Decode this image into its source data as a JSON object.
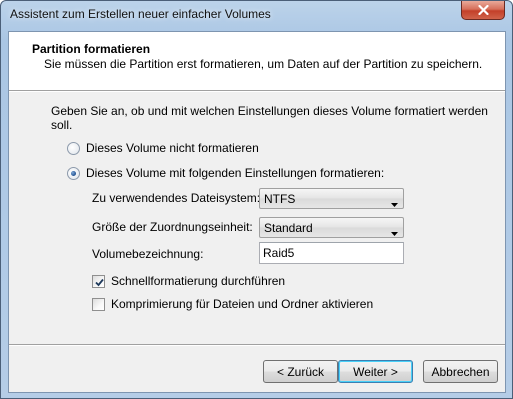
{
  "window": {
    "title": "Assistent zum Erstellen neuer einfacher Volumes",
    "close_icon": "close-icon"
  },
  "header": {
    "title": "Partition formatieren",
    "subtitle": "Sie müssen die Partition erst formatieren, um Daten auf der Partition zu speichern."
  },
  "body": {
    "instruction": "Geben Sie an, ob und mit welchen Einstellungen dieses Volume formatiert werden soll.",
    "radio_no_format": {
      "label": "Dieses Volume nicht formatieren",
      "selected": false
    },
    "radio_format": {
      "label": "Dieses Volume mit folgenden Einstellungen formatieren:",
      "selected": true
    },
    "filesystem": {
      "label": "Zu verwendendes Dateisystem:",
      "value": "NTFS"
    },
    "allocation_unit": {
      "label": "Größe der Zuordnungseinheit:",
      "value": "Standard"
    },
    "volume_label": {
      "label": "Volumebezeichnung:",
      "value": "Raid5"
    },
    "quick_format": {
      "label": "Schnellformatierung durchführen",
      "checked": true
    },
    "compression": {
      "label": "Komprimierung für Dateien und Ordner aktivieren",
      "checked": false
    }
  },
  "footer": {
    "back_label": "< Zurück",
    "next_label": "Weiter >",
    "cancel_label": "Abbrechen"
  },
  "colors": {
    "title_bar": "#aac6e4",
    "dialog_bg": "#f0f0f0",
    "default_button_border": "#3c7fb1"
  }
}
